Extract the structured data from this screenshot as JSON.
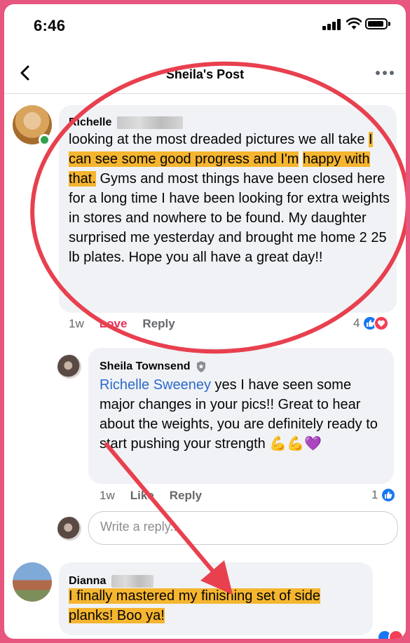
{
  "status_bar": {
    "time": "6:46"
  },
  "nav": {
    "title": "Sheila's Post"
  },
  "comments": [
    {
      "author": "Richelle",
      "text_pre": "looking at the most dreaded pictures we all take ",
      "text_hl1": "I can see some good progress and I'm",
      "text_hl2": "happy with that.",
      "text_post": " Gyms and most things have been closed here for a long time I have been looking for extra weights in stores and nowhere to be found. My daughter surprised me yesterday and brought me home 2 25 lb plates.  Hope you all have a great day!!",
      "time": "1w",
      "love_label": "Love",
      "reply_label": "Reply",
      "reaction_count": "4",
      "online": true
    },
    {
      "author": "Sheila Townsend",
      "mention": "Richelle Sweeney",
      "text": " yes I have seen some major changes in your pics!!  Great to hear about the weights, you are definitely ready to start pushing your strength ",
      "emojis": "💪💪💜",
      "time": "1w",
      "like_label": "Like",
      "reply_label": "Reply",
      "reaction_count": "1"
    },
    {
      "author": "Dianna",
      "text_hl1": "I finally mastered my finishing set of side",
      "text_hl2": "planks! Boo ya!"
    }
  ],
  "reply_box": {
    "placeholder": "Write a reply..."
  },
  "colors": {
    "frame": "#e6567f",
    "highlight": "#f5b52f",
    "annotation": "#e8404f",
    "mention": "#2d6acb",
    "love": "#e4325a"
  },
  "icons": [
    "back-icon",
    "more-icon",
    "like-icon",
    "heart-icon",
    "verified-icon",
    "signal-icon",
    "wifi-icon",
    "battery-icon"
  ]
}
